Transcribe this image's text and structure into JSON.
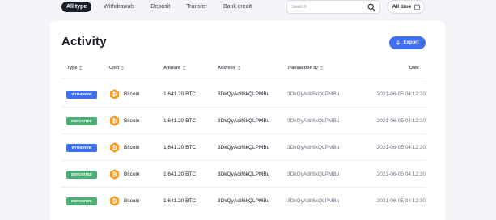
{
  "filters": {
    "tabs": [
      {
        "label": "All type",
        "active": true
      },
      {
        "label": "Withdrawals",
        "active": false
      },
      {
        "label": "Deposit",
        "active": false
      },
      {
        "label": "Transfer",
        "active": false
      },
      {
        "label": "Bank credit",
        "active": false
      }
    ],
    "search_placeholder": "Search",
    "time_label": "All time"
  },
  "activity": {
    "title": "Activity",
    "export_label": "Export",
    "columns": {
      "type": "Type",
      "coin": "Coin",
      "amount": "Amount",
      "address": "Address",
      "txid": "Transaction ID",
      "date": "Date"
    },
    "rows": [
      {
        "type": "WITHDREW",
        "coin": "Bitcoin",
        "amount": "1,641.20 BTC",
        "address": "3DkQyAdif6kQLPMBu",
        "txid": "3DkQyAdif6kQLPMBu",
        "date": "2021-06-05 04:12:30"
      },
      {
        "type": "DEPOSITED",
        "coin": "Bitcoin",
        "amount": "1,641.20 BTC",
        "address": "3DkQyAdif6kQLPMBu",
        "txid": "3DkQyAdif6kQLPMBu",
        "date": "2021-06-05 04:12:30"
      },
      {
        "type": "WITHDREW",
        "coin": "Bitcoin",
        "amount": "1,641.20 BTC",
        "address": "3DkQyAdif6kQLPMBu",
        "txid": "3DkQyAdif6kQLPMBu",
        "date": "2021-06-05 04:12:30"
      },
      {
        "type": "DEPOSITED",
        "coin": "Bitcoin",
        "amount": "1,641.20 BTC",
        "address": "3DkQyAdif6kQLPMBu",
        "txid": "3DkQyAdif6kQLPMBu",
        "date": "2021-06-05 04:12:30"
      },
      {
        "type": "DEPOSITED",
        "coin": "Bitcoin",
        "amount": "1,641.20 BTC",
        "address": "3DkQyAdif6kQLPMBu",
        "txid": "3DkQyAdif6kQLPMBu",
        "date": "2021-06-05 04:12:30"
      }
    ]
  },
  "colors": {
    "withdrew": "#3f6ff2",
    "deposited": "#4caf74",
    "bitcoin": "#f59a23",
    "accent": "#3f6ff2"
  },
  "icons": {
    "search": "search-icon",
    "calendar": "calendar-icon",
    "export": "download-icon",
    "sort": "sort-icon",
    "coin": "bitcoin-icon"
  }
}
